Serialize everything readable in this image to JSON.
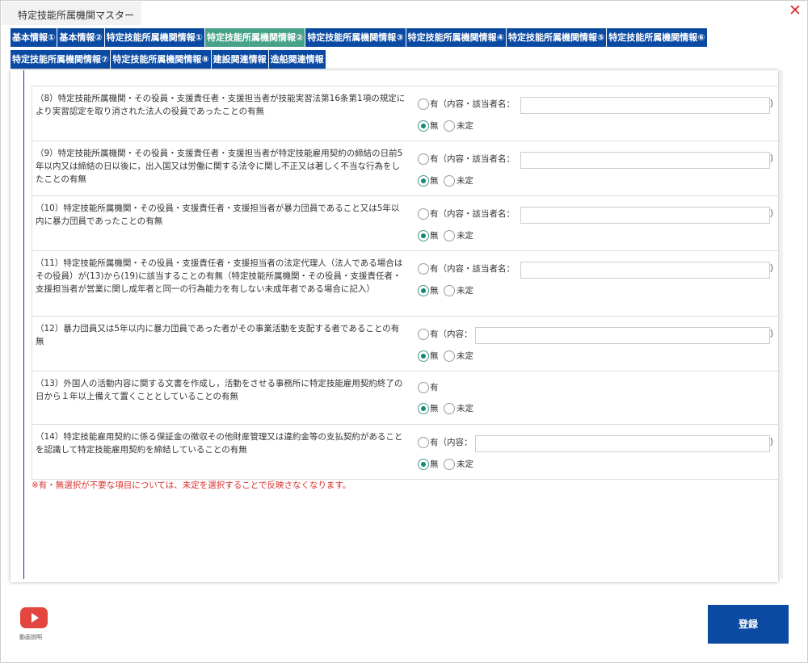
{
  "window": {
    "title": "特定技能所属機関マスター"
  },
  "tabs": [
    {
      "label": "基本情報①",
      "active": false
    },
    {
      "label": "基本情報②",
      "active": false
    },
    {
      "label": "特定技能所属機関情報①",
      "active": false
    },
    {
      "label": "特定技能所属機関情報②",
      "active": true
    },
    {
      "label": "特定技能所属機関情報③",
      "active": false
    },
    {
      "label": "特定技能所属機関情報④",
      "active": false
    },
    {
      "label": "特定技能所属機関情報⑤",
      "active": false
    },
    {
      "label": "特定技能所属機関情報⑥",
      "active": false
    },
    {
      "label": "特定技能所属機関情報⑦",
      "active": false
    },
    {
      "label": "特定技能所属機関情報⑧",
      "active": false
    },
    {
      "label": "建設関連情報",
      "active": false
    },
    {
      "label": "造船関連情報",
      "active": false
    }
  ],
  "questions": [
    {
      "text": "（8）特定技能所属機関・その役員・支援責任者・支援担当者が技能実習法第16条第1項の規定により実習認定を取り消された法人の役員であったことの有無",
      "yes_label": "有（内容・該当者名：",
      "input_value": "",
      "no_label": "無",
      "undecided_label": "未定",
      "selected": "no"
    },
    {
      "text": "（9）特定技能所属機関・その役員・支援責任者・支援担当者が特定技能雇用契約の締結の日前5年以内又は締結の日以後に，出入国又は労働に関する法令に関し不正又は著しく不当な行為をしたことの有無",
      "yes_label": "有（内容・該当者名：",
      "input_value": "",
      "no_label": "無",
      "undecided_label": "未定",
      "selected": "no"
    },
    {
      "text": "（10）特定技能所属機関・その役員・支援責任者・支援担当者が暴力団員であること又は5年以内に暴力団員であったことの有無",
      "yes_label": "有（内容・該当者名：",
      "input_value": "",
      "no_label": "無",
      "undecided_label": "未定",
      "selected": "no"
    },
    {
      "text": "（11）特定技能所属機関・その役員・支援責任者・支援担当者の法定代理人（法人である場合はその役員）が(13)から(19)に該当することの有無（特定技能所属機関・その役員・支援責任者・支援担当者が営業に関し成年者と同一の行為能力を有しない未成年者である場合に記入）",
      "yes_label": "有（内容・該当者名：",
      "input_value": "",
      "no_label": "無",
      "undecided_label": "未定",
      "selected": "no"
    },
    {
      "text": "（12）暴力団員又は5年以内に暴力団員であった者がその事業活動を支配する者であることの有無",
      "yes_label": "有（内容：",
      "input_value": "",
      "no_label": "無",
      "undecided_label": "未定",
      "selected": "no"
    },
    {
      "text": "（13）外国人の活動内容に関する文書を作成し，活動をさせる事務所に特定技能雇用契約終了の日から１年以上備えて置くこととしていることの有無",
      "yes_label": "有",
      "no_label": "無",
      "undecided_label": "未定",
      "selected": "no"
    },
    {
      "text": "（14）特定技能雇用契約に係る保証金の徴収その他財産管理又は違約金等の支払契約があることを認識して特定技能雇用契約を締結していることの有無",
      "yes_label": "有（内容：",
      "input_value": "",
      "no_label": "無",
      "undecided_label": "未定",
      "selected": "no"
    }
  ],
  "paren_close": "）",
  "note": "※有・無選択が不要な項目については、未定を選択することで反映さなくなります。",
  "footer": {
    "video_label": "動画説明",
    "video_icon": "youtube-play-icon",
    "register_label": "登録",
    "close_icon": "close-x-icon"
  },
  "colors": {
    "tab_bg": "#0b4aa2",
    "tab_active_bg": "#47a287",
    "radio_checked": "#138a76",
    "note": "#d9302c",
    "close": "#d9302c",
    "register_bg": "#0b4aa2"
  }
}
